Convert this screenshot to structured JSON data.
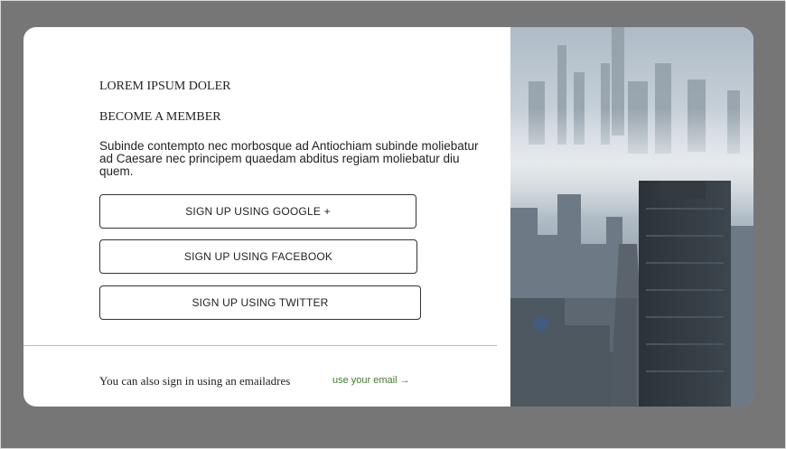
{
  "brand": {
    "title": "LOREM IPSUM DOLER"
  },
  "signup": {
    "subtitle": "BECOME A MEMBER",
    "description": "Subinde contempto nec morbosque ad Antiochiam subinde moliebatur ad Caesare nec principem quaedam abditus regiam moliebatur diu quem.",
    "buttons": {
      "google": "SIGN UP USING GOOGLE +",
      "facebook": "SIGN UP USING FACEBOOK",
      "twitter": "SIGN UP USING TWITTER"
    }
  },
  "footer": {
    "text": "You can also sign in using an emailadres",
    "email_link": "use your email →"
  },
  "colors": {
    "page_background": "#767676",
    "card_background": "#ffffff",
    "link_green": "#3c7d2c",
    "button_border": "#333333"
  },
  "image": {
    "subject": "foggy city skyline aerial photo"
  }
}
